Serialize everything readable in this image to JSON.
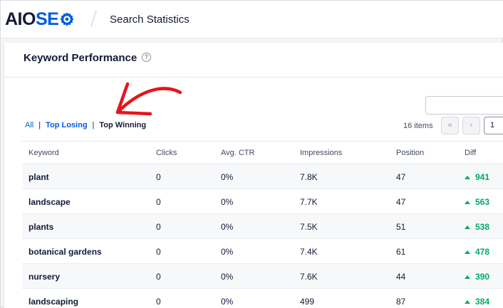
{
  "brand": {
    "logo_aio": "AIO",
    "logo_seo": "SE",
    "accent": "#005ae0"
  },
  "header": {
    "title": "Search Statistics"
  },
  "card": {
    "title": "Keyword Performance"
  },
  "filters": {
    "all": "All",
    "top_losing": "Top Losing",
    "top_winning": "Top Winning",
    "separator": "|"
  },
  "pagination": {
    "items": "16 items",
    "first": "«",
    "prev": "‹",
    "page": "1"
  },
  "table": {
    "headers": {
      "keyword": "Keyword",
      "clicks": "Clicks",
      "ctr": "Avg. CTR",
      "impressions": "Impressions",
      "position": "Position",
      "diff": "Diff"
    },
    "rows": [
      {
        "keyword": "plant",
        "clicks": "0",
        "ctr": "0%",
        "impressions": "7.8K",
        "position": "47",
        "diff": "941"
      },
      {
        "keyword": "landscape",
        "clicks": "0",
        "ctr": "0%",
        "impressions": "7.7K",
        "position": "47",
        "diff": "563"
      },
      {
        "keyword": "plants",
        "clicks": "0",
        "ctr": "0%",
        "impressions": "7.5K",
        "position": "51",
        "diff": "538"
      },
      {
        "keyword": "botanical gardens",
        "clicks": "0",
        "ctr": "0%",
        "impressions": "7.4K",
        "position": "61",
        "diff": "478"
      },
      {
        "keyword": "nursery",
        "clicks": "0",
        "ctr": "0%",
        "impressions": "7.6K",
        "position": "44",
        "diff": "390"
      },
      {
        "keyword": "landscaping",
        "clicks": "0",
        "ctr": "0%",
        "impressions": "499",
        "position": "87",
        "diff": "384"
      }
    ]
  },
  "colors": {
    "positive": "#00aa63",
    "annotation": "#e8141b"
  }
}
